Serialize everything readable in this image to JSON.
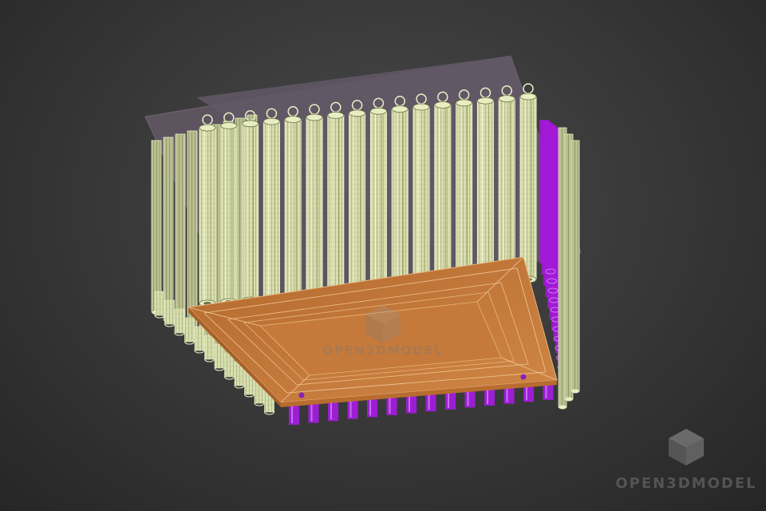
{
  "watermark": {
    "center_text": "OPEN3DMODEL",
    "corner_text": "OPEN3DMODEL",
    "logo_icon": "cube-logo-icon"
  },
  "scene": {
    "subject": "wireframe-chandelier-model",
    "back_plate_color": "#5e5460",
    "rod_color": "#e7eec2",
    "rod_wire_color": "#6b7046",
    "hidden_rod_color": "#a21ad8",
    "tray_color": "#c57a3b",
    "tray_wire_color": "#f0c99a"
  }
}
